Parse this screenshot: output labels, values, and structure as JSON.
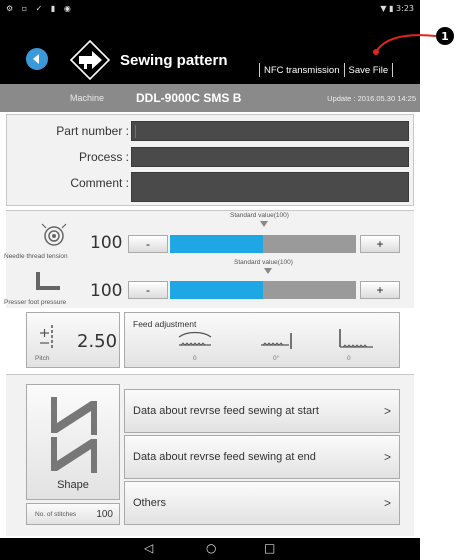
{
  "status_bar": {
    "left_icons": "⚙ ▫ ✓ ▮ ◉",
    "right": "▼ ▮ 3:23"
  },
  "header": {
    "title": "Sewing pattern",
    "actions": [
      "NFC transmission",
      "Save File"
    ],
    "callout_number": "1"
  },
  "machine": {
    "label": "Machine",
    "model": "DDL-9000C SMS B",
    "update": "Update : 2016.05.30  14:25"
  },
  "form": {
    "fields": [
      {
        "label": "Part number :",
        "value": ""
      },
      {
        "label": "Process :",
        "value": ""
      },
      {
        "label": "Comment :",
        "value": ""
      }
    ]
  },
  "needle_tension": {
    "standard_label": "Standard value(100)",
    "value": "100",
    "label": "Needle thread tension",
    "minus": "-",
    "plus": "+",
    "level": 0.5
  },
  "presser_pressure": {
    "standard_label": "Standard value(100)",
    "value": "100",
    "label": "Presser foot pressure",
    "minus": "-",
    "plus": "+",
    "level": 0.5
  },
  "pitch": {
    "value": "2.50",
    "label": "Pitch"
  },
  "feed": {
    "title": "Feed adjustment",
    "values": [
      "0",
      "0°",
      "0"
    ]
  },
  "shape": {
    "label": "Shape",
    "stitch_label": "No. of stitches",
    "stitch_value": "100"
  },
  "menu": [
    {
      "label": "Data about revrse feed sewing at start",
      "chevron": ">"
    },
    {
      "label": "Data about revrse feed sewing at end",
      "chevron": ">"
    },
    {
      "label": "Others",
      "chevron": ">"
    }
  ],
  "nav": {
    "back": "◁",
    "home": "○",
    "recent": "□"
  }
}
